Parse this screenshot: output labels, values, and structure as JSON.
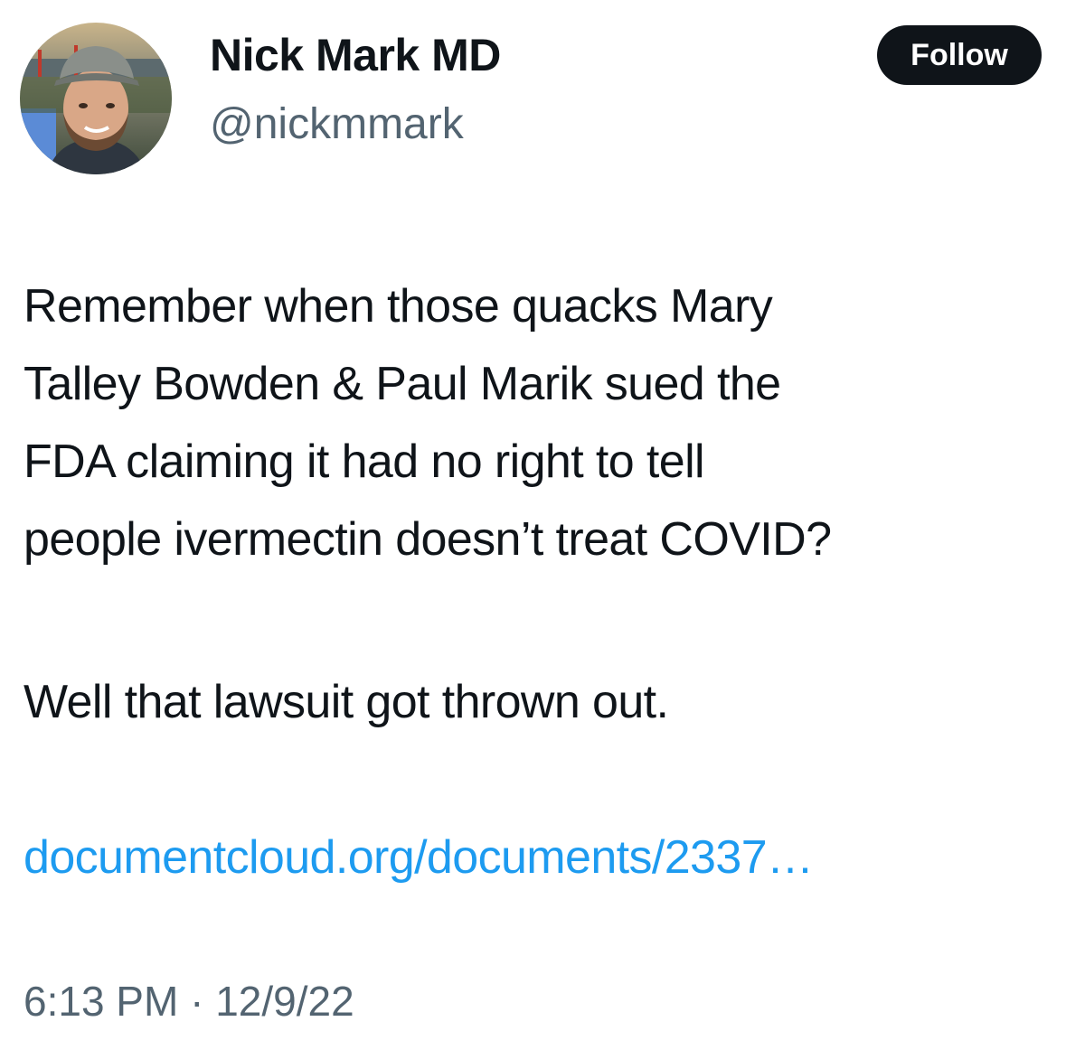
{
  "author": {
    "display_name": "Nick Mark MD",
    "handle": "@nickmmark"
  },
  "follow_button": {
    "label": "Follow"
  },
  "tweet": {
    "lines": [
      "Remember when those quacks Mary",
      "Talley Bowden & Paul Marik sued the",
      "FDA claiming it had no right to tell",
      "people ivermectin doesn’t treat COVID?"
    ],
    "second_paragraph": "Well that lawsuit got thrown out.",
    "link_text": "documentcloud.org/documents/2337…"
  },
  "timestamp": {
    "time": "6:13 PM",
    "separator": " · ",
    "date": "12/9/22"
  },
  "colors": {
    "text": "#0f1419",
    "secondary_text": "#536471",
    "link": "#1d9bf0",
    "follow_button_bg": "#0f1419"
  }
}
